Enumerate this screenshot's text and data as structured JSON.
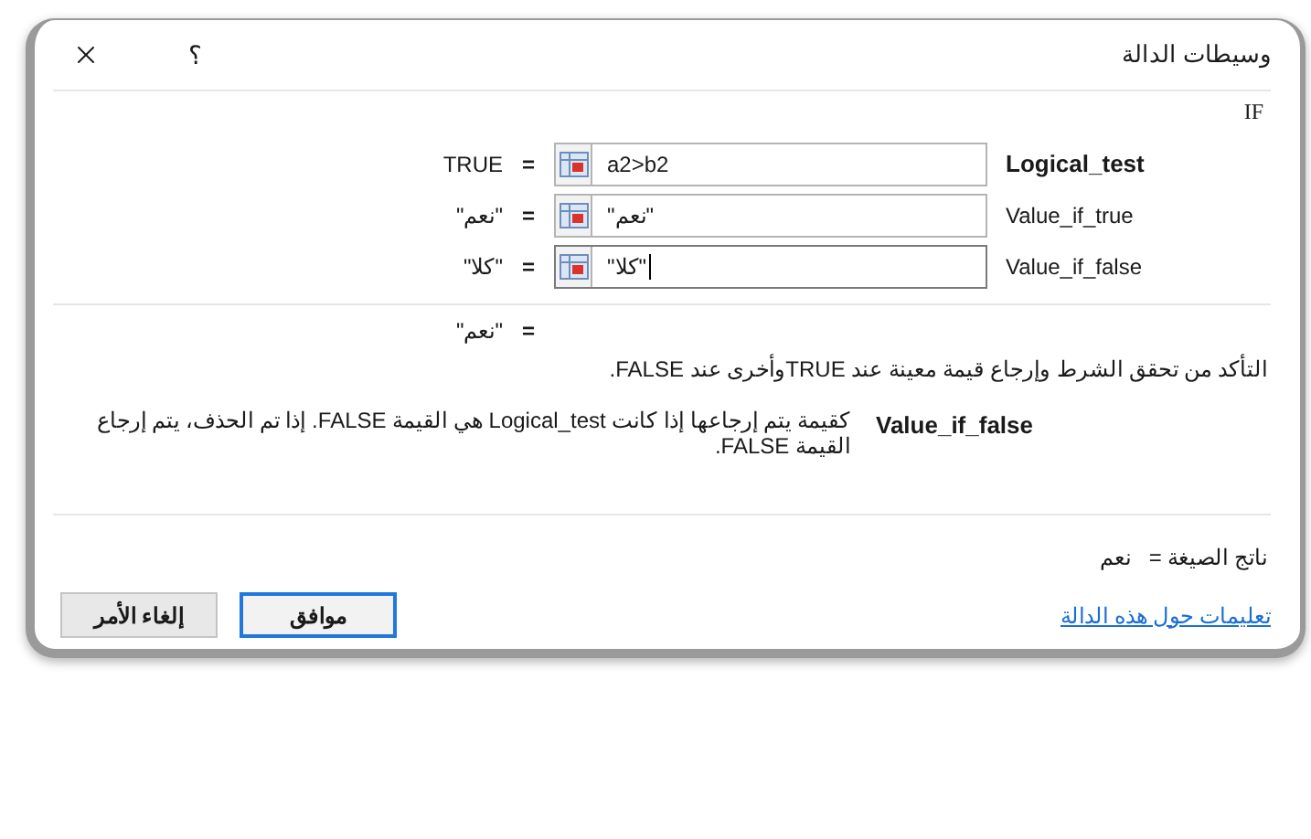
{
  "window": {
    "title": "وسيطات الدالة",
    "help": "؟"
  },
  "function_name": "IF",
  "arguments": [
    {
      "name": "Logical_test",
      "required": true,
      "value": "a2>b2",
      "focused": false,
      "equals": "=",
      "result": "TRUE"
    },
    {
      "name": "Value_if_true",
      "required": false,
      "value": "\"نعم\"",
      "focused": false,
      "equals": "=",
      "result": "\"نعم\""
    },
    {
      "name": "Value_if_false",
      "required": false,
      "value": "\"كلا\"",
      "focused": true,
      "equals": "=",
      "result": "\"كلا\""
    }
  ],
  "function_result": "\"نعم\"",
  "function_result_equals": "=",
  "description": "التأكد من تحقق الشرط وإرجاع قيمة معينة عند TRUEوأخرى عند FALSE.",
  "argument_help": {
    "name": "Value_if_false",
    "text": "كقيمة يتم إرجاعها إذا كانت Logical_test هي القيمة FALSE. إذا تم الحذف، يتم إرجاع القيمة FALSE."
  },
  "formula_result": {
    "label": "ناتج الصيغة =",
    "value": "نعم"
  },
  "help_link": "تعليمات حول هذه الدالة",
  "buttons": [
    {
      "label": "موافق",
      "default": true
    },
    {
      "label": "إلغاء الأمر",
      "default": false
    }
  ]
}
